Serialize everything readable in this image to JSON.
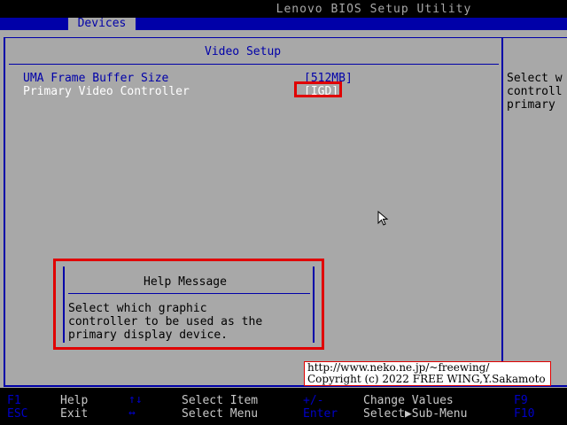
{
  "app": {
    "title": "Lenovo BIOS Setup Utility"
  },
  "menu": {
    "active_tab": "Devices"
  },
  "section": {
    "title": "Video Setup"
  },
  "settings": [
    {
      "label": "UMA Frame Buffer Size",
      "value": "[512MB]"
    },
    {
      "label": "Primary Video Controller",
      "value": "[IGD]"
    }
  ],
  "side_help": {
    "lines": [
      "Select w",
      "controll",
      "primary"
    ]
  },
  "help_popup": {
    "title": "Help Message",
    "lines": [
      "Select which graphic",
      "controller to be used as the",
      "primary display device."
    ]
  },
  "watermark": {
    "line1": "http://www.neko.ne.jp/~freewing/",
    "line2": "Copyright (c) 2022 FREE WING,Y.Sakamoto"
  },
  "footer": {
    "row1": [
      {
        "key": "F1",
        "desc": "Help"
      },
      {
        "key": "↑↓",
        "desc": "Select Item"
      },
      {
        "key": "+/-",
        "desc": "Change Values"
      },
      {
        "key": "F9",
        "desc": ""
      }
    ],
    "row2": [
      {
        "key": "ESC",
        "desc": "Exit"
      },
      {
        "key": "↔",
        "desc": "Select Menu"
      },
      {
        "key": "Enter",
        "desc": "Select▶Sub-Menu"
      },
      {
        "key": "F10",
        "desc": ""
      }
    ]
  },
  "colors": {
    "bg": "#a8a8a8",
    "accent_blue": "#0000a8",
    "highlight_red": "#e00000",
    "footer_bg": "#000000"
  }
}
